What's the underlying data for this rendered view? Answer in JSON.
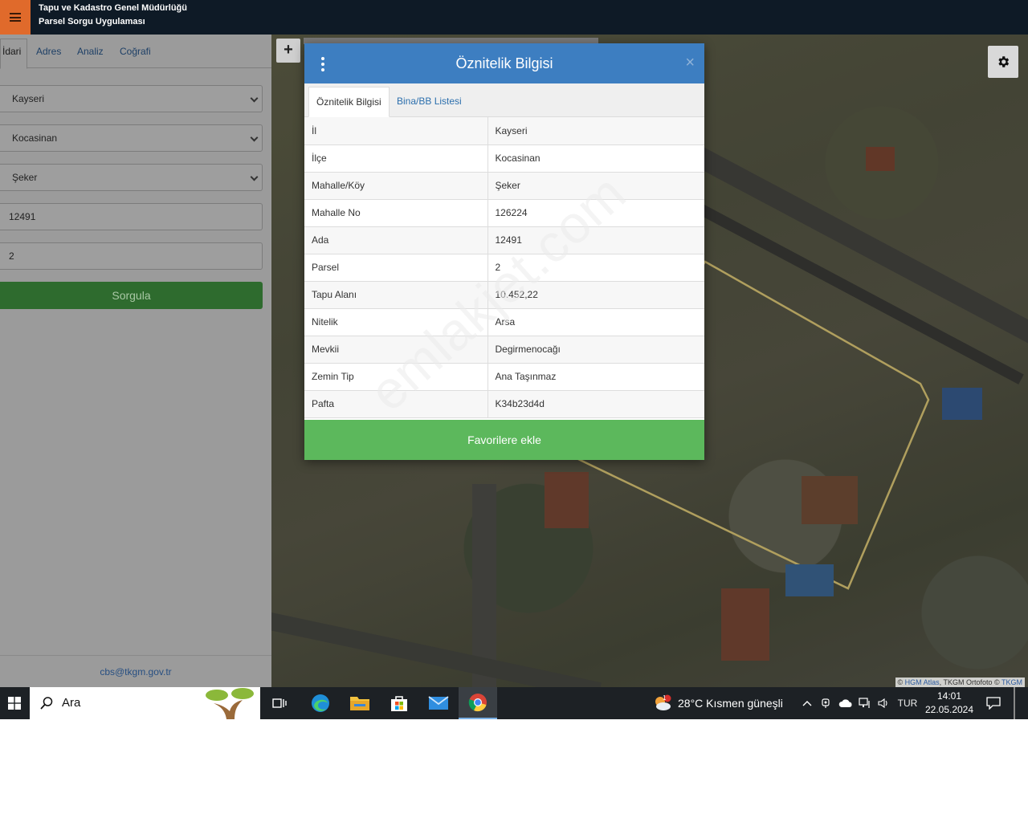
{
  "header": {
    "title_line1": "Tapu ve Kadastro Genel Müdürlüğü",
    "title_line2": "Parsel Sorgu Uygulaması"
  },
  "sidebar": {
    "tabs": [
      {
        "label": "İdari",
        "active": true
      },
      {
        "label": "Adres",
        "active": false
      },
      {
        "label": "Analiz",
        "active": false
      },
      {
        "label": "Coğrafi",
        "active": false
      }
    ],
    "il": "Kayseri",
    "ilce": "Kocasinan",
    "mahalle": "Şeker",
    "ada": "12491",
    "parsel": "2",
    "query_button": "Sorgula",
    "contact_email": "cbs@tkgm.gov.tr"
  },
  "map": {
    "zoom_in": "+",
    "attribution_prefix": "© ",
    "attribution_link1": "HGM Atlas",
    "attribution_middle": ", TKGM Ortofoto © ",
    "attribution_link2": "TKGM"
  },
  "modal": {
    "title": "Öznitelik Bilgisi",
    "close": "×",
    "tabs": [
      "Öznitelik Bilgisi",
      "Bina/BB Listesi"
    ],
    "rows": [
      {
        "key": "İl",
        "value": "Kayseri"
      },
      {
        "key": "İlçe",
        "value": "Kocasinan"
      },
      {
        "key": "Mahalle/Köy",
        "value": "Şeker"
      },
      {
        "key": "Mahalle No",
        "value": "126224"
      },
      {
        "key": "Ada",
        "value": "12491"
      },
      {
        "key": "Parsel",
        "value": "2"
      },
      {
        "key": "Tapu Alanı",
        "value": "10.452,22"
      },
      {
        "key": "Nitelik",
        "value": "Arsa"
      },
      {
        "key": "Mevkii",
        "value": "Degirmenocağı"
      },
      {
        "key": "Zemin Tip",
        "value": "Ana Taşınmaz"
      },
      {
        "key": "Pafta",
        "value": "K34b23d4d"
      }
    ],
    "favorite_button": "Favorilere ekle"
  },
  "watermark": "emlakjet.com",
  "taskbar": {
    "search_placeholder": "Ara",
    "weather": "28°C  Kısmen güneşli",
    "weather_badge": "1",
    "language": "TUR",
    "time": "14:01",
    "date": "22.05.2024"
  },
  "colors": {
    "header_bg": "#0e1a26",
    "menu_accent": "#e06a2b",
    "modal_header": "#3d7ec1",
    "favorite_green": "#5cb85c",
    "parcel_outline": "#c8b46a"
  }
}
